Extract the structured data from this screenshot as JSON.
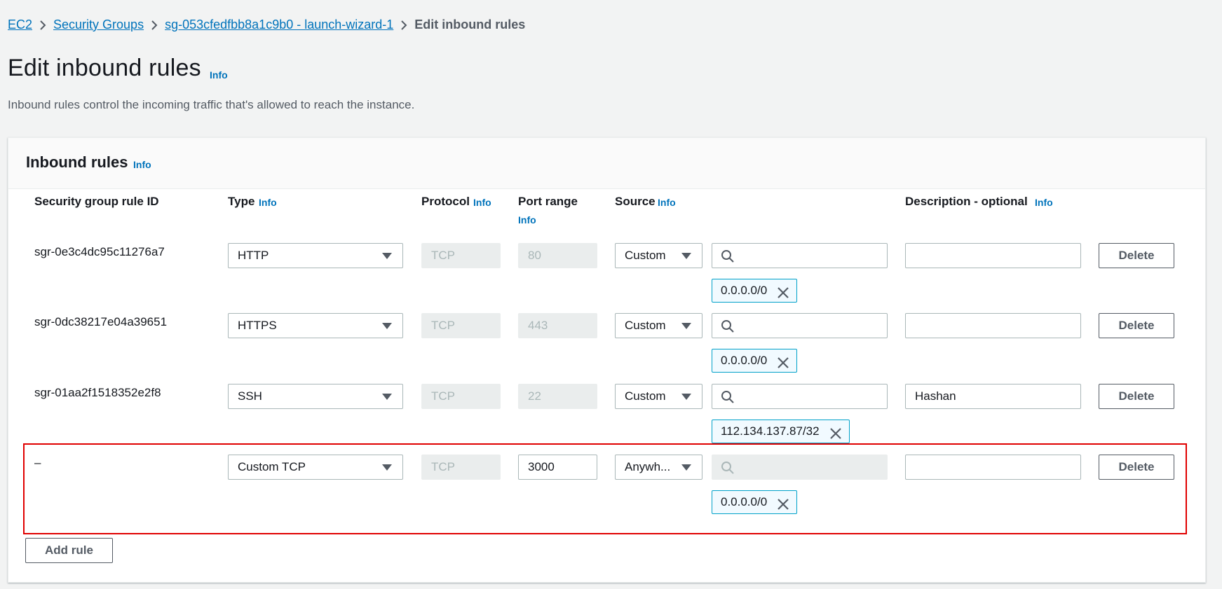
{
  "breadcrumb": {
    "items": [
      "EC2",
      "Security Groups",
      "sg-053cfedfbb8a1c9b0 - launch-wizard-1"
    ],
    "current": "Edit inbound rules"
  },
  "page": {
    "title": "Edit inbound rules",
    "title_info": "Info",
    "description": "Inbound rules control the incoming traffic that's allowed to reach the instance."
  },
  "panel": {
    "title": "Inbound rules",
    "info": "Info",
    "columns": {
      "rule_id": "Security group rule ID",
      "type": "Type",
      "protocol": "Protocol",
      "port_range": "Port range",
      "source": "Source",
      "description": "Description - optional",
      "info": "Info"
    },
    "rules": [
      {
        "id": "sgr-0e3c4dc95c11276a7",
        "type": "HTTP",
        "protocol": "TCP",
        "port": "80",
        "source": "Custom",
        "search": "",
        "token": "0.0.0.0/0",
        "description": "",
        "delete": "Delete"
      },
      {
        "id": "sgr-0dc38217e04a39651",
        "type": "HTTPS",
        "protocol": "TCP",
        "port": "443",
        "source": "Custom",
        "search": "",
        "token": "0.0.0.0/0",
        "description": "",
        "delete": "Delete"
      },
      {
        "id": "sgr-01aa2f1518352e2f8",
        "type": "SSH",
        "protocol": "TCP",
        "port": "22",
        "source": "Custom",
        "search": "",
        "token": "112.134.137.87/32",
        "description": "Hashan",
        "delete": "Delete"
      },
      {
        "id": "–",
        "type": "Custom TCP",
        "protocol": "TCP",
        "port": "3000",
        "source": "Anywh...",
        "search": "",
        "token": "0.0.0.0/0",
        "description": "",
        "delete": "Delete"
      }
    ],
    "add_rule": "Add rule"
  },
  "colors": {
    "link": "#0073bb",
    "token_border": "#00a1c9",
    "highlight": "#e00000"
  }
}
